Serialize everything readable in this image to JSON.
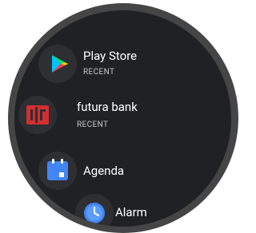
{
  "apps": [
    {
      "name": "Play Store",
      "subtitle": "RECENT",
      "icon": "play-store-icon"
    },
    {
      "name": "futura bank",
      "subtitle": "RECENT",
      "icon": "futura-bank-icon"
    },
    {
      "name": "Agenda",
      "subtitle": "",
      "icon": "calendar-icon"
    },
    {
      "name": "Alarm",
      "subtitle": "",
      "icon": "alarm-clock-icon"
    }
  ],
  "colors": {
    "screen_bg": "#202124",
    "bezel": "#454545",
    "icon_bg": "#2e2f33",
    "calendar_blue": "#4285f4",
    "bank_red": "#d32f2f"
  }
}
